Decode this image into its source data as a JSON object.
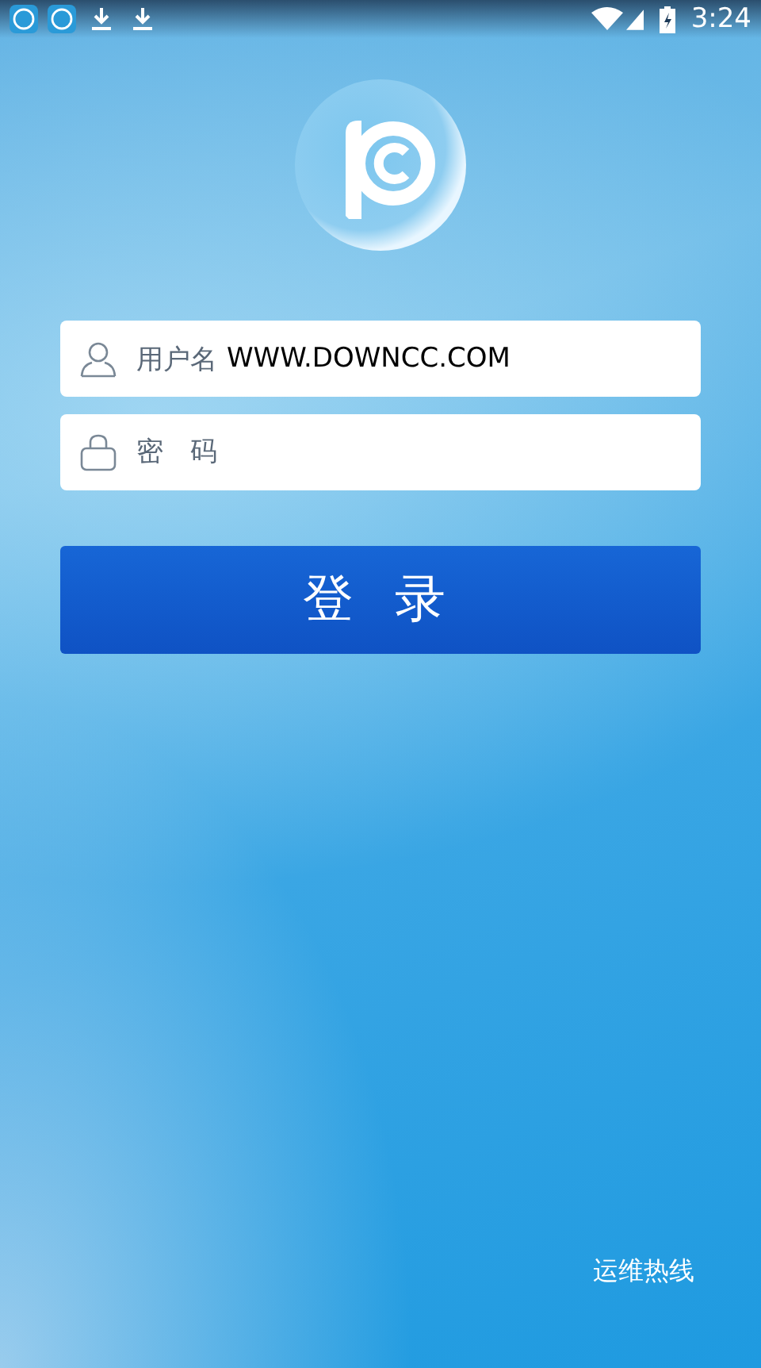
{
  "status_bar": {
    "time": "3:24"
  },
  "login_form": {
    "username": {
      "label": "用户名",
      "value": "WWW.DOWNCC.COM"
    },
    "password": {
      "placeholder": "密　码"
    },
    "login_button": "登 录"
  },
  "footer": {
    "hotline": "运维热线"
  }
}
